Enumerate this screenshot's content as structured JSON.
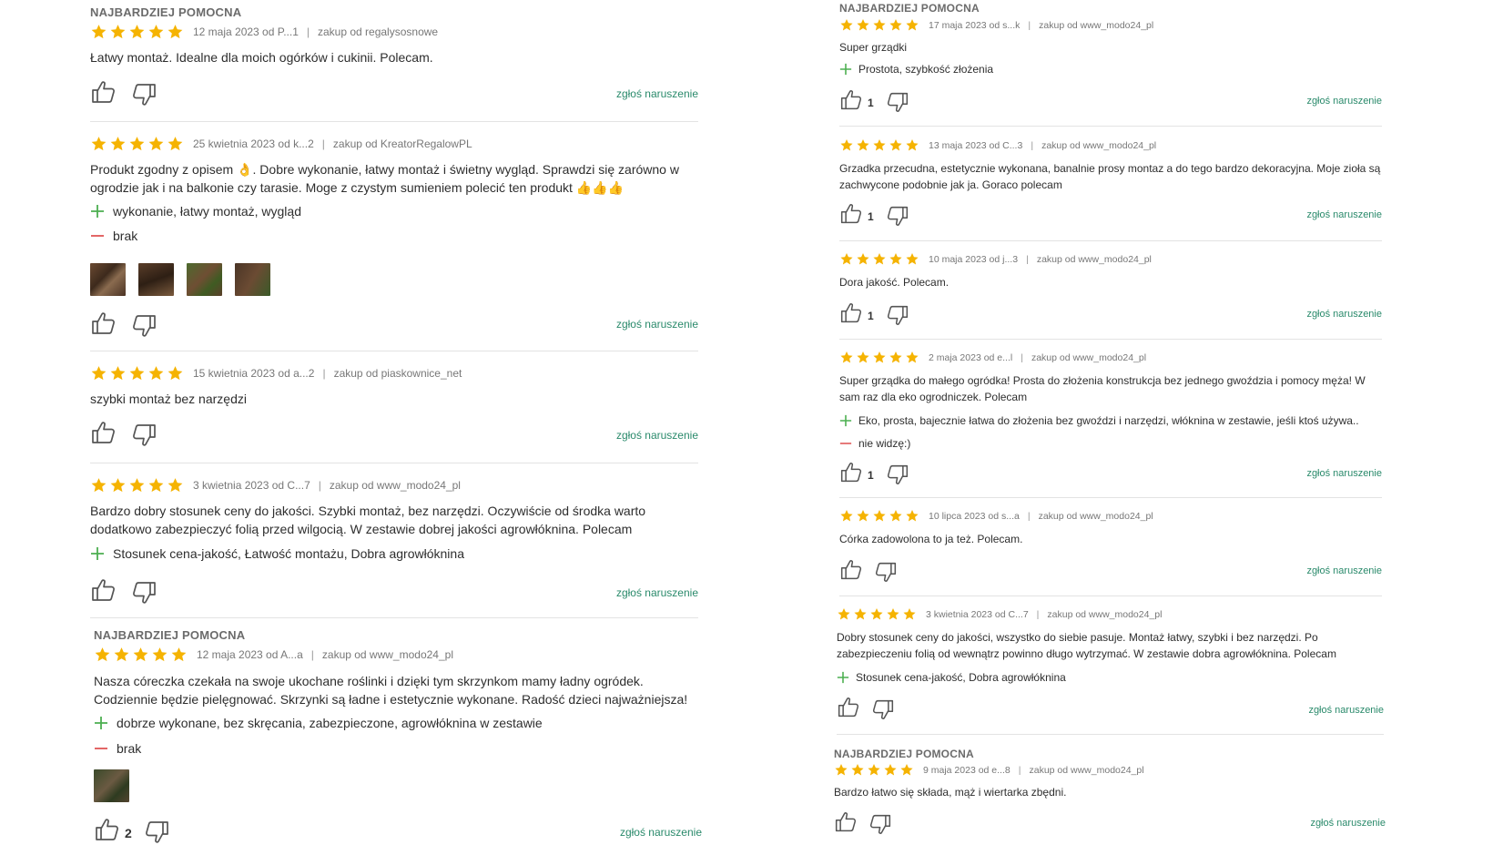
{
  "colors": {
    "star": "#f5b301",
    "plus": "#4caf50",
    "minus": "#e05656",
    "report": "#2a8a6b"
  },
  "report_label": "zgłoś naruszenie",
  "helpful_label": "NAJBARDZIEJ POMOCNA",
  "left": [
    {
      "date_author": "12 maja 2023 od P...1",
      "purchase": "zakup od regalysosnowe",
      "text": "Łatwy montaż. Idealne dla moich ogórków i cukinii. Polecam.",
      "up": ""
    },
    {
      "date_author": "25 kwietnia 2023 od k...2",
      "purchase": "zakup od KreatorRegalowPL",
      "text1": "Produkt zgodny z opisem",
      "emoji1": "👌",
      "text2": ". Dobre wykonanie, łatwy montaż i świetny wygląd. Sprawdzi się zarówno w",
      "text3": "ogrodzie jak i na balkonie czy tarasie. Moge z czystym sumieniem polecić ten produkt",
      "emoji2": "👍👍👍",
      "pros": "wykonanie, łatwy montaż, wygląd",
      "cons": "brak",
      "up": ""
    },
    {
      "date_author": "15 kwietnia 2023 od a...2",
      "purchase": "zakup od piaskownice_net",
      "text": "szybki montaż bez narzędzi",
      "up": ""
    },
    {
      "date_author": "3 kwietnia 2023 od C...7",
      "purchase": "zakup od www_modo24_pl",
      "text": "Bardzo dobry stosunek ceny do jakości. Szybki montaż, bez narzędzi. Oczywiście od środka warto dodatkowo zabezpieczyć folią przed wilgocią. W zestawie dobrej jakości agrowłóknina. Polecam",
      "pros": "Stosunek cena-jakość, Łatwość montażu, Dobra agrowłóknina",
      "up": ""
    },
    {
      "date_author": "12 maja 2023 od A...a",
      "purchase": "zakup od www_modo24_pl",
      "text": "Nasza córeczka czekała na swoje ukochane roślinki i dzięki tym skrzynkom mamy ładny ogródek. Codziennie będzie pielęgnować. Skrzynki są ładne i estetycznie wykonane. Radość dzieci najważniejsza!",
      "pros": "dobrze wykonane, bez skręcania, zabezpieczone, agrowłóknina w zestawie",
      "cons": "brak",
      "up": "2"
    }
  ],
  "right": [
    {
      "date_author": "17 maja 2023 od s...k",
      "purchase": "zakup od www_modo24_pl",
      "text": "Super grządki",
      "pros": "Prostota, szybkość złożenia",
      "up": "1"
    },
    {
      "date_author": "13 maja 2023 od C...3",
      "purchase": "zakup od www_modo24_pl",
      "text": "Grzadka przecudna, estetycznie wykonana, banalnie prosy montaz a do tego bardzo dekoracyjna. Moje zioła są zachwycone podobnie jak ja. Goraco polecam",
      "up": "1"
    },
    {
      "date_author": "10 maja 2023 od j...3",
      "purchase": "zakup od www_modo24_pl",
      "text": "Dora jakość. Polecam.",
      "up": "1"
    },
    {
      "date_author": "2 maja 2023 od e...l",
      "purchase": "zakup od www_modo24_pl",
      "text": "Super grządka do małego ogródka! Prosta do złożenia konstrukcja bez jednego gwoździa i pomocy męża! W sam raz dla eko ogrodniczek. Polecam",
      "pros": "Eko, prosta, bajecznie łatwa do złożenia bez gwoździ i narzędzi, włóknina w zestawie, jeśli ktoś używa..",
      "cons": "nie widzę:)",
      "up": "1"
    },
    {
      "date_author": "10 lipca 2023 od s...a",
      "purchase": "zakup od www_modo24_pl",
      "text": "Córka zadowolona to ja też. Polecam.",
      "up": ""
    },
    {
      "date_author": "3 kwietnia 2023 od C...7",
      "purchase": "zakup od www_modo24_pl",
      "text": "Dobry stosunek ceny do jakości, wszystko do siebie pasuje. Montaż łatwy, szybki i bez narzędzi. Po zabezpieczeniu folią od wewnątrz powinno długo wytrzymać. W zestawie dobra agrowłóknina. Polecam",
      "pros": "Stosunek cena-jakość, Dobra agrowłóknina",
      "up": ""
    },
    {
      "date_author": "9 maja 2023 od e...8",
      "purchase": "zakup od www_modo24_pl",
      "text": "Bardzo łatwo się składa, mąż i wiertarka zbędni.",
      "up": ""
    }
  ]
}
